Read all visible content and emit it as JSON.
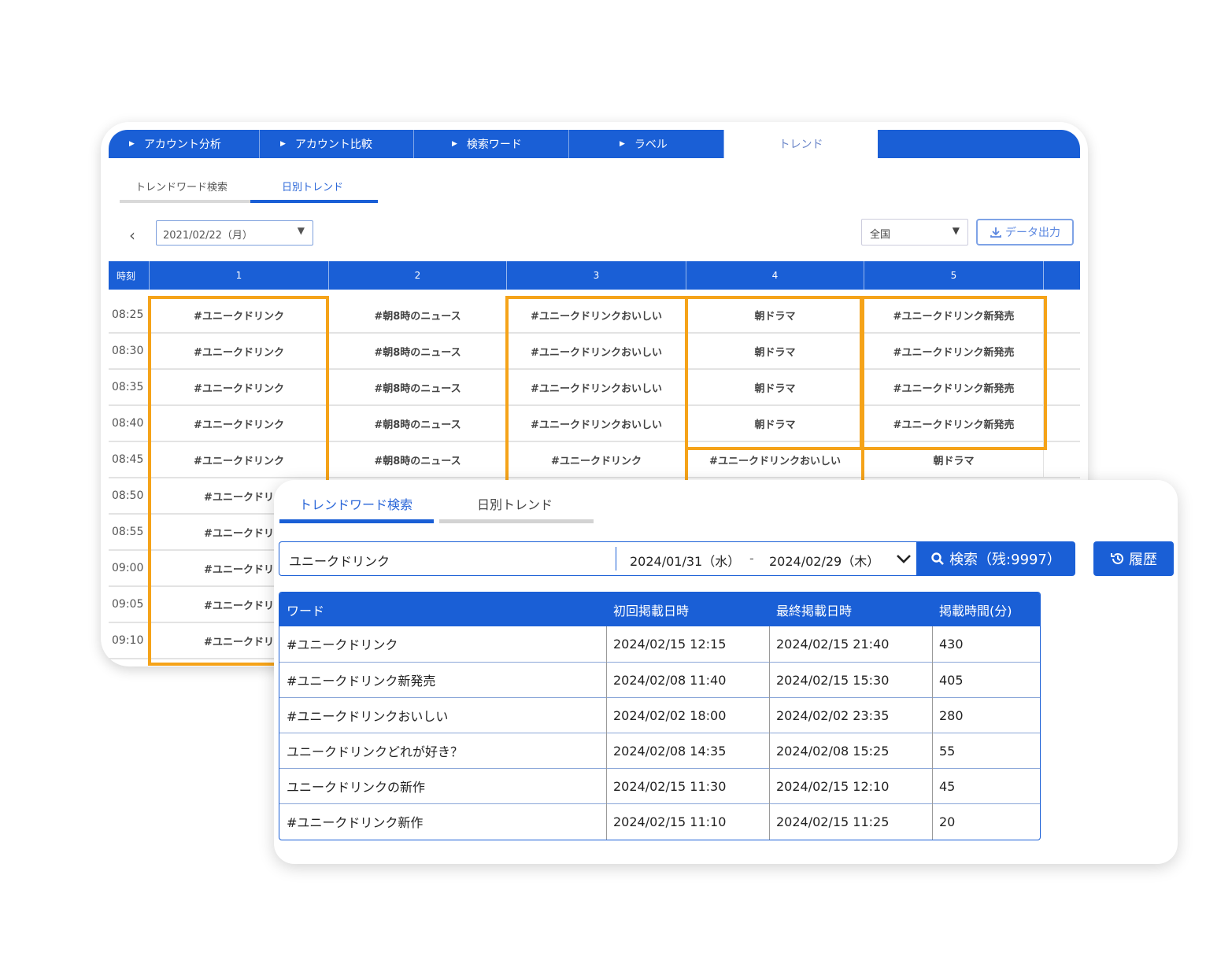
{
  "back_panel": {
    "top_tabs": [
      "アカウント分析",
      "アカウント比較",
      "検索ワード",
      "ラベル",
      "トレンド"
    ],
    "active_top_tab": "トレンド",
    "sub_tabs": [
      "トレンドワード検索",
      "日別トレンド"
    ],
    "active_sub_tab": "日別トレンド",
    "date_select": "2021/02/22（月）",
    "region_select": "全国",
    "export_label": "データ出力",
    "grid_headers": [
      "時刻",
      "1",
      "2",
      "3",
      "4",
      "5"
    ],
    "rows": [
      {
        "time": "08:25",
        "cells": [
          "#ユニークドリンク",
          "#朝8時のニュース",
          "#ユニークドリンクおいしい",
          "朝ドラマ",
          "#ユニークドリンク新発売"
        ]
      },
      {
        "time": "08:30",
        "cells": [
          "#ユニークドリンク",
          "#朝8時のニュース",
          "#ユニークドリンクおいしい",
          "朝ドラマ",
          "#ユニークドリンク新発売"
        ]
      },
      {
        "time": "08:35",
        "cells": [
          "#ユニークドリンク",
          "#朝8時のニュース",
          "#ユニークドリンクおいしい",
          "朝ドラマ",
          "#ユニークドリンク新発売"
        ]
      },
      {
        "time": "08:40",
        "cells": [
          "#ユニークドリンク",
          "#朝8時のニュース",
          "#ユニークドリンクおいしい",
          "朝ドラマ",
          "#ユニークドリンク新発売"
        ]
      },
      {
        "time": "08:45",
        "cells": [
          "#ユニークドリンク",
          "#朝8時のニュース",
          "#ユニークドリンク",
          "#ユニークドリンクおいしい",
          "朝ドラマ"
        ]
      },
      {
        "time": "08:50",
        "cells": [
          "#ユニークドリ"
        ]
      },
      {
        "time": "08:55",
        "cells": [
          "#ユニークドリ"
        ]
      },
      {
        "time": "09:00",
        "cells": [
          "#ユニークドリ"
        ]
      },
      {
        "time": "09:05",
        "cells": [
          "#ユニークドリ"
        ]
      },
      {
        "time": "09:10",
        "cells": [
          "#ユニークドリ"
        ]
      }
    ]
  },
  "front_panel": {
    "tabs": [
      "トレンドワード検索",
      "日別トレンド"
    ],
    "active_tab": "トレンドワード検索",
    "search": {
      "keyword": "ユニークドリンク",
      "date_from": "2024/01/31（水）",
      "date_separator": "-",
      "date_to": "2024/02/29（木）",
      "search_button": "検索（残:9997）",
      "history_button": "履歴"
    },
    "table": {
      "headers": [
        "ワード",
        "初回掲載日時",
        "最終掲載日時",
        "掲載時間(分)"
      ],
      "rows": [
        [
          "#ユニークドリンク",
          "2024/02/15 12:15",
          "2024/02/15 21:40",
          "430"
        ],
        [
          "#ユニークドリンク新発売",
          "2024/02/08 11:40",
          "2024/02/15 15:30",
          "405"
        ],
        [
          "#ユニークドリンクおいしい",
          "2024/02/02 18:00",
          "2024/02/02 23:35",
          "280"
        ],
        [
          "ユニークドリンクどれが好き？",
          "2024/02/08 14:35",
          "2024/02/08 15:25",
          "55"
        ],
        [
          "ユニークドリンクの新作",
          "2024/02/15 11:30",
          "2024/02/15 12:10",
          "45"
        ],
        [
          "#ユニークドリンク新作",
          "2024/02/15 11:10",
          "2024/02/15 11:25",
          "20"
        ]
      ]
    }
  },
  "colors": {
    "primary": "#1a5fd6",
    "highlight": "#f5a319"
  }
}
